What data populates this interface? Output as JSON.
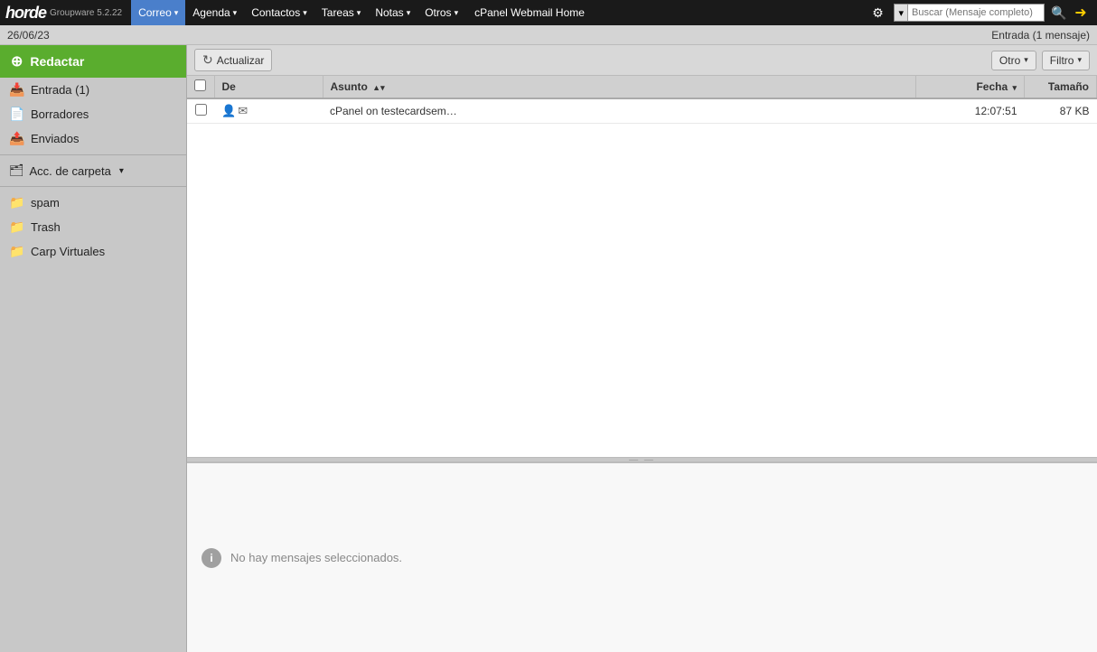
{
  "app": {
    "name": "horde",
    "version": "Groupware 5.2.22"
  },
  "topnav": {
    "items": [
      {
        "id": "correo",
        "label": "Correo",
        "active": true,
        "hasArrow": true
      },
      {
        "id": "agenda",
        "label": "Agenda",
        "hasArrow": true
      },
      {
        "id": "contactos",
        "label": "Contactos",
        "hasArrow": true
      },
      {
        "id": "tareas",
        "label": "Tareas",
        "hasArrow": true
      },
      {
        "id": "notas",
        "label": "Notas",
        "hasArrow": true
      },
      {
        "id": "otros",
        "label": "Otros",
        "hasArrow": true
      },
      {
        "id": "cpanel",
        "label": "cPanel Webmail Home",
        "hasArrow": false
      }
    ],
    "search": {
      "dropdown_label": "▾",
      "placeholder": "Buscar (Mensaje completo)"
    }
  },
  "datebar": {
    "date": "26/06/23",
    "inbox_status": "Entrada (1 mensaje)"
  },
  "sidebar": {
    "compose_label": "Redactar",
    "items": [
      {
        "id": "entrada",
        "label": "Entrada (1)",
        "icon": "inbox"
      },
      {
        "id": "borradores",
        "label": "Borradores",
        "icon": "draft"
      },
      {
        "id": "enviados",
        "label": "Enviados",
        "icon": "sent"
      }
    ],
    "acc_carpeta_label": "Acc. de carpeta",
    "extra_items": [
      {
        "id": "spam",
        "label": "spam",
        "icon": "folder"
      },
      {
        "id": "trash",
        "label": "Trash",
        "icon": "folder"
      },
      {
        "id": "carp-virtuales",
        "label": "Carp Virtuales",
        "icon": "folder"
      }
    ]
  },
  "toolbar": {
    "refresh_label": "Actualizar",
    "other_label": "Otro",
    "filter_label": "Filtro"
  },
  "table": {
    "columns": {
      "checkbox": "",
      "de": "De",
      "asunto": "Asunto",
      "fecha": "Fecha",
      "tamano": "Tamaño"
    },
    "rows": [
      {
        "id": "msg1",
        "de": "cPanel on testecardsem…",
        "asunto": "",
        "fecha": "12:07:51",
        "tamano": "87 KB"
      }
    ]
  },
  "preview": {
    "no_selection_text": "No hay mensajes seleccionados."
  }
}
